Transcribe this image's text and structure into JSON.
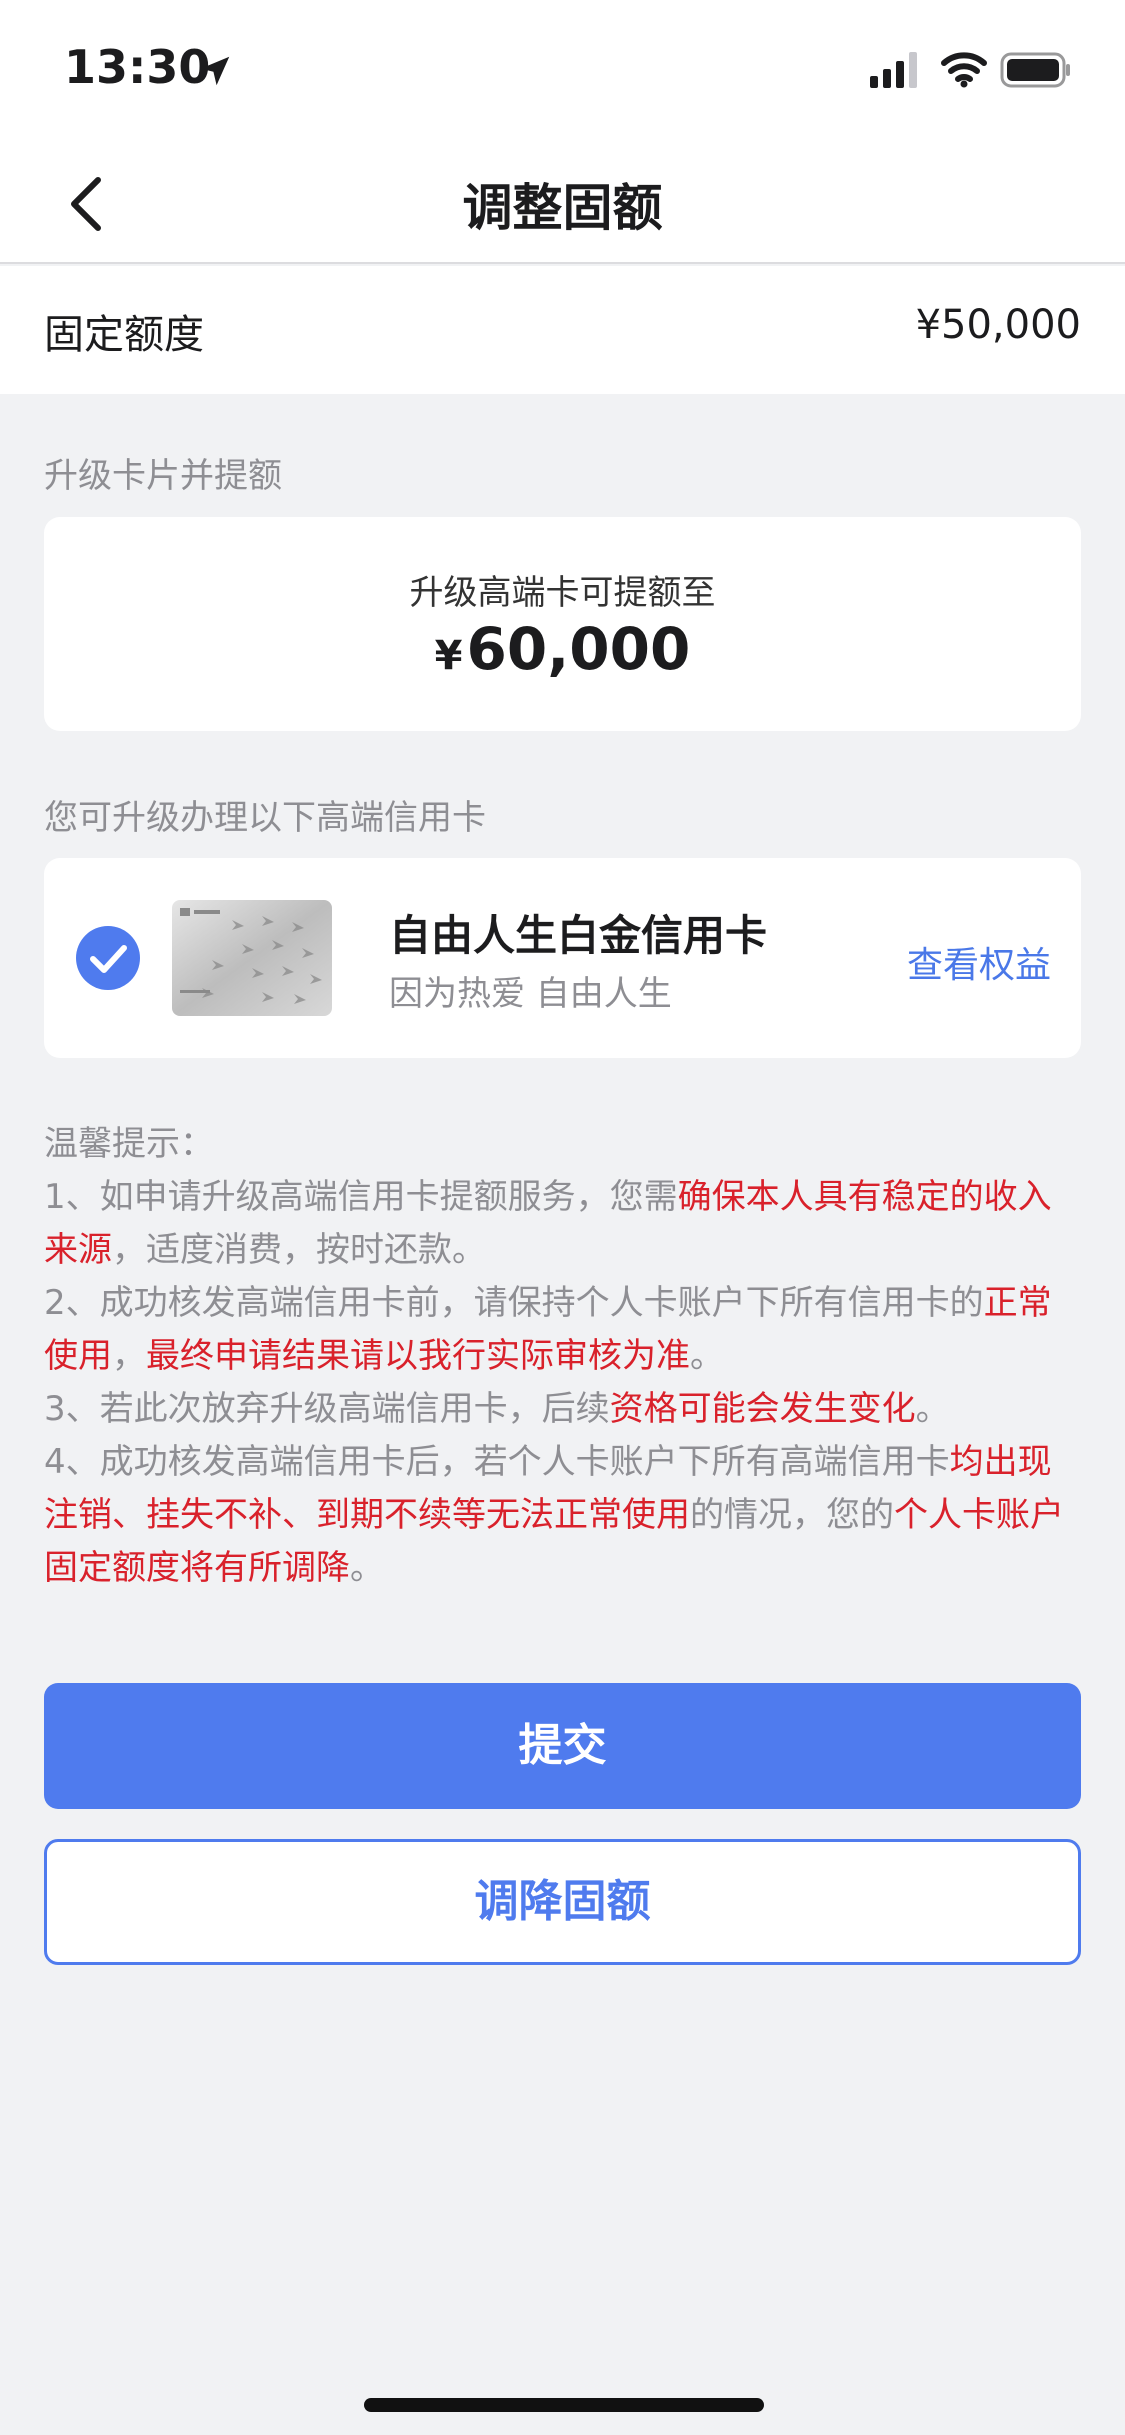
{
  "status_bar": {
    "time": "13:30"
  },
  "nav": {
    "title": "调整固额"
  },
  "fixed_limit": {
    "label": "固定额度",
    "value": "¥50,000"
  },
  "upgrade_section": {
    "label": "升级卡片并提额",
    "line1": "升级高端卡可提额至",
    "currency": "¥",
    "amount": "60,000"
  },
  "card_section": {
    "label": "您可升级办理以下高端信用卡",
    "card": {
      "name": "自由人生白金信用卡",
      "slogan": "因为热爱 自由人生",
      "link": "查看权益",
      "selected": true
    }
  },
  "tips": {
    "title": "温馨提示：",
    "t1a": "1、如申请升级高端信用卡提额服务，您需",
    "t1b": "确保本人具有稳定的收入来源",
    "t1c": "，适度消费，按时还款。",
    "t2a": "2、成功核发高端信用卡前，请保持个人卡账户下所有信用卡的",
    "t2b": "正常使用",
    "t2c": "，",
    "t2d": "最终申请结果请以我行实际审核为准",
    "t2e": "。",
    "t3a": "3、若此次放弃升级高端信用卡，后续",
    "t3b": "资格可能会发生变化",
    "t3c": "。",
    "t4a": "4、成功核发高端信用卡后，若个人卡账户下所有高端信用卡",
    "t4b": "均出现注销、挂失不补、到期不续等无法正常使用",
    "t4c": "的情况，您的",
    "t4d": "个人卡账户固定额度将有所调降",
    "t4e": "。"
  },
  "buttons": {
    "submit": "提交",
    "decrease": "调降固额"
  },
  "colors": {
    "accent": "#4f7bee",
    "warning": "#d9212b",
    "link": "#4a78e8"
  }
}
